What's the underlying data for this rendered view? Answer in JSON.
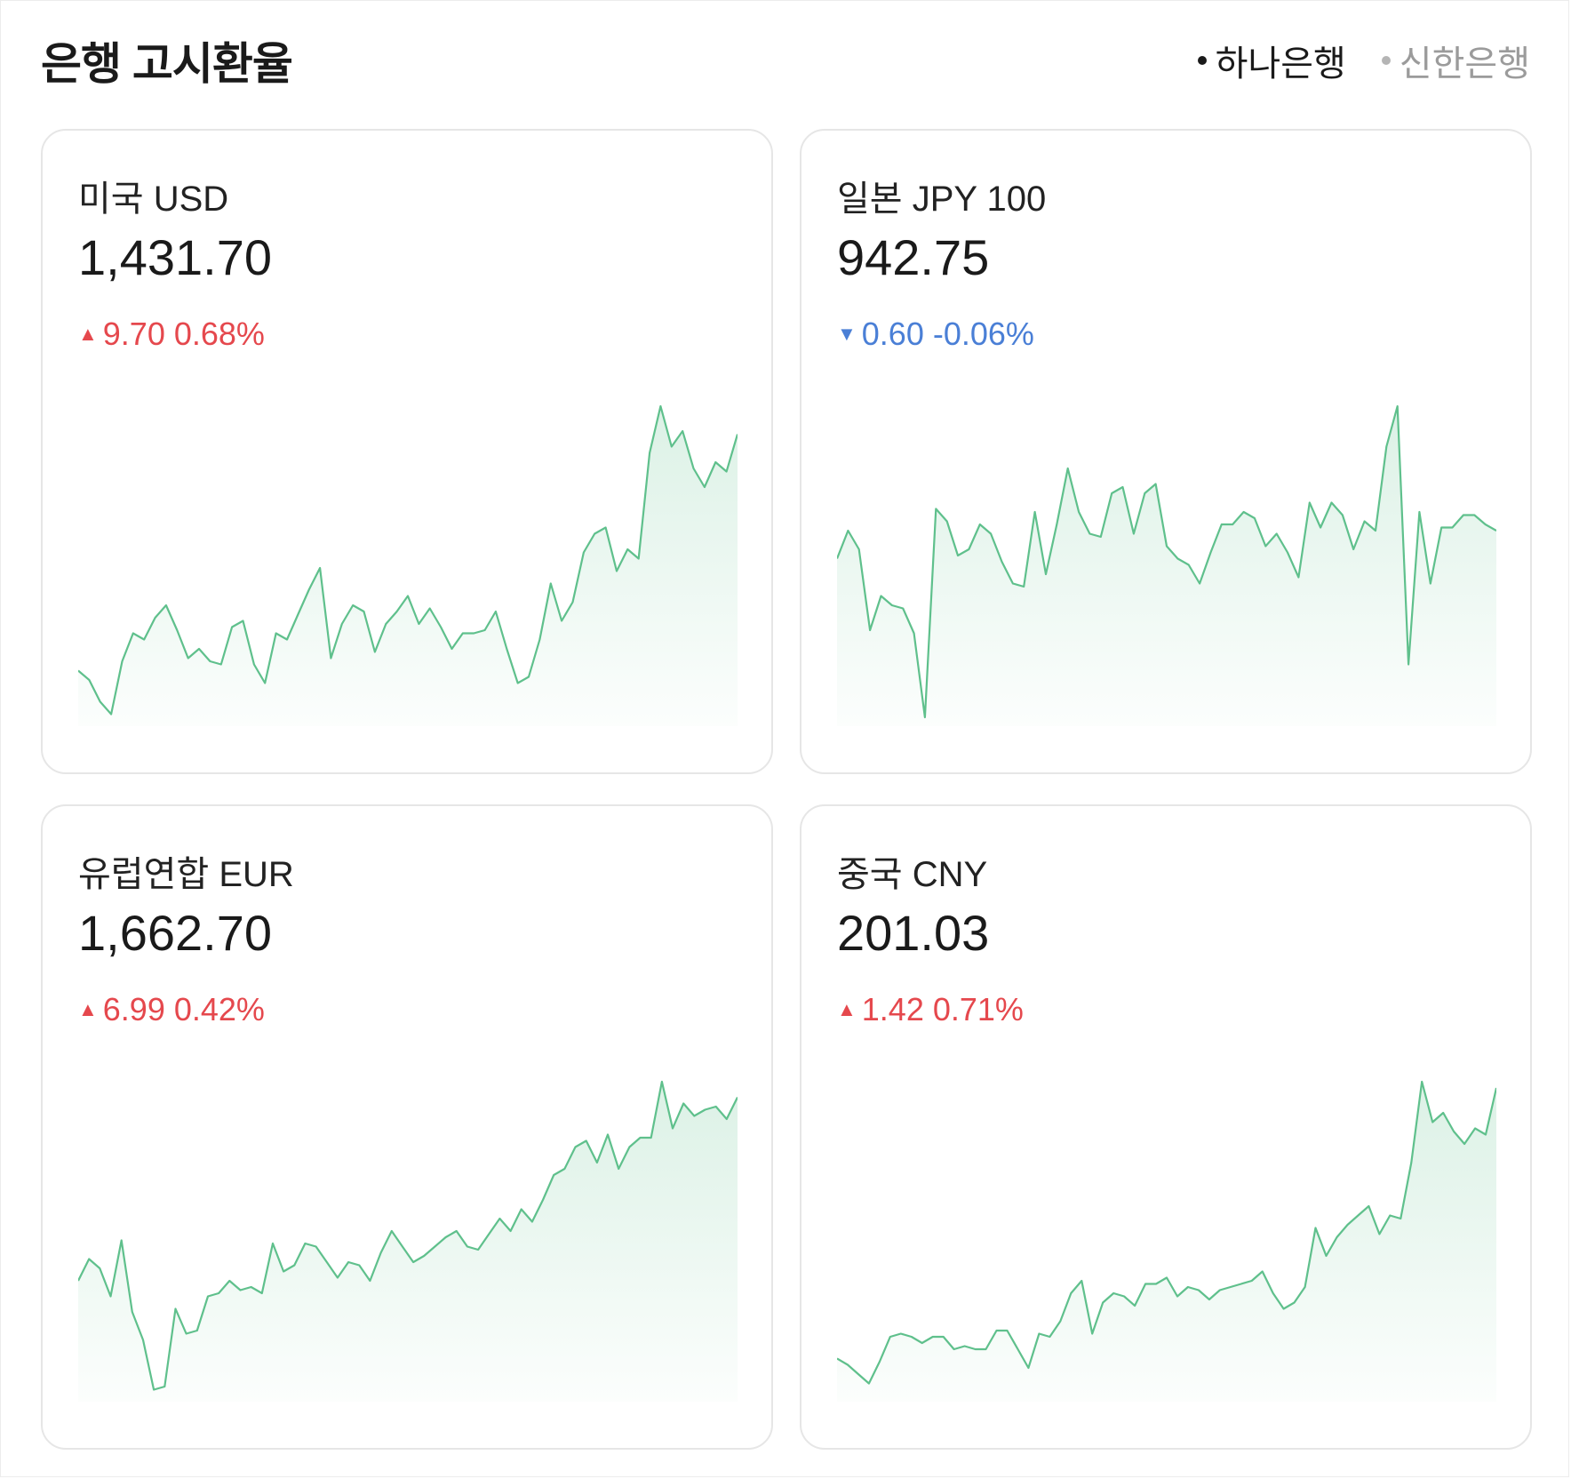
{
  "header": {
    "title": "은행 고시환율",
    "banks": [
      {
        "label": "하나은행",
        "active": true
      },
      {
        "label": "신한은행",
        "active": false
      }
    ]
  },
  "colors": {
    "up": "#e5484d",
    "down": "#4a7fd6",
    "line": "#5fc08c"
  },
  "cards": [
    {
      "name": "미국 USD",
      "rate": "1,431.70",
      "change": "9.70 0.68%",
      "direction": "up",
      "series": [
        0.15,
        0.12,
        0.05,
        0.01,
        0.18,
        0.27,
        0.25,
        0.32,
        0.36,
        0.28,
        0.19,
        0.22,
        0.18,
        0.17,
        0.29,
        0.31,
        0.17,
        0.11,
        0.27,
        0.25,
        0.33,
        0.41,
        0.48,
        0.19,
        0.3,
        0.36,
        0.34,
        0.21,
        0.3,
        0.34,
        0.39,
        0.3,
        0.35,
        0.29,
        0.22,
        0.27,
        0.27,
        0.28,
        0.34,
        0.22,
        0.11,
        0.13,
        0.25,
        0.43,
        0.31,
        0.37,
        0.53,
        0.59,
        0.61,
        0.47,
        0.54,
        0.51,
        0.85,
        1.0,
        0.87,
        0.92,
        0.8,
        0.74,
        0.82,
        0.79,
        0.91
      ]
    },
    {
      "name": "일본 JPY 100",
      "rate": "942.75",
      "change": "0.60 -0.06%",
      "direction": "down",
      "series": [
        0.51,
        0.6,
        0.54,
        0.28,
        0.39,
        0.36,
        0.35,
        0.27,
        0.0,
        0.67,
        0.63,
        0.52,
        0.54,
        0.62,
        0.59,
        0.5,
        0.43,
        0.42,
        0.66,
        0.46,
        0.62,
        0.8,
        0.66,
        0.59,
        0.58,
        0.72,
        0.74,
        0.59,
        0.72,
        0.75,
        0.55,
        0.51,
        0.49,
        0.43,
        0.53,
        0.62,
        0.62,
        0.66,
        0.64,
        0.55,
        0.59,
        0.53,
        0.45,
        0.69,
        0.61,
        0.69,
        0.65,
        0.54,
        0.63,
        0.6,
        0.87,
        1.0,
        0.17,
        0.66,
        0.43,
        0.61,
        0.61,
        0.65,
        0.65,
        0.62,
        0.6
      ]
    },
    {
      "name": "유럽연합 EUR",
      "rate": "1,662.70",
      "change": "6.99 0.42%",
      "direction": "up",
      "series": [
        0.36,
        0.43,
        0.4,
        0.31,
        0.49,
        0.26,
        0.17,
        0.01,
        0.02,
        0.27,
        0.19,
        0.2,
        0.31,
        0.32,
        0.36,
        0.33,
        0.34,
        0.32,
        0.48,
        0.39,
        0.41,
        0.48,
        0.47,
        0.42,
        0.37,
        0.42,
        0.41,
        0.36,
        0.45,
        0.52,
        0.47,
        0.42,
        0.44,
        0.47,
        0.5,
        0.52,
        0.47,
        0.46,
        0.51,
        0.56,
        0.52,
        0.59,
        0.55,
        0.62,
        0.7,
        0.72,
        0.79,
        0.81,
        0.74,
        0.83,
        0.72,
        0.79,
        0.82,
        0.82,
        1.0,
        0.85,
        0.93,
        0.89,
        0.91,
        0.92,
        0.88,
        0.95
      ]
    },
    {
      "name": "중국 CNY",
      "rate": "201.03",
      "change": "1.42 0.71%",
      "direction": "up",
      "series": [
        0.11,
        0.09,
        0.06,
        0.03,
        0.1,
        0.18,
        0.19,
        0.18,
        0.16,
        0.18,
        0.18,
        0.14,
        0.15,
        0.14,
        0.14,
        0.2,
        0.2,
        0.14,
        0.08,
        0.19,
        0.18,
        0.23,
        0.32,
        0.36,
        0.19,
        0.29,
        0.32,
        0.31,
        0.28,
        0.35,
        0.35,
        0.37,
        0.31,
        0.34,
        0.33,
        0.3,
        0.33,
        0.34,
        0.35,
        0.36,
        0.39,
        0.32,
        0.27,
        0.29,
        0.34,
        0.53,
        0.44,
        0.5,
        0.54,
        0.57,
        0.6,
        0.51,
        0.57,
        0.56,
        0.74,
        1.0,
        0.87,
        0.9,
        0.84,
        0.8,
        0.85,
        0.83,
        0.98
      ]
    }
  ]
}
